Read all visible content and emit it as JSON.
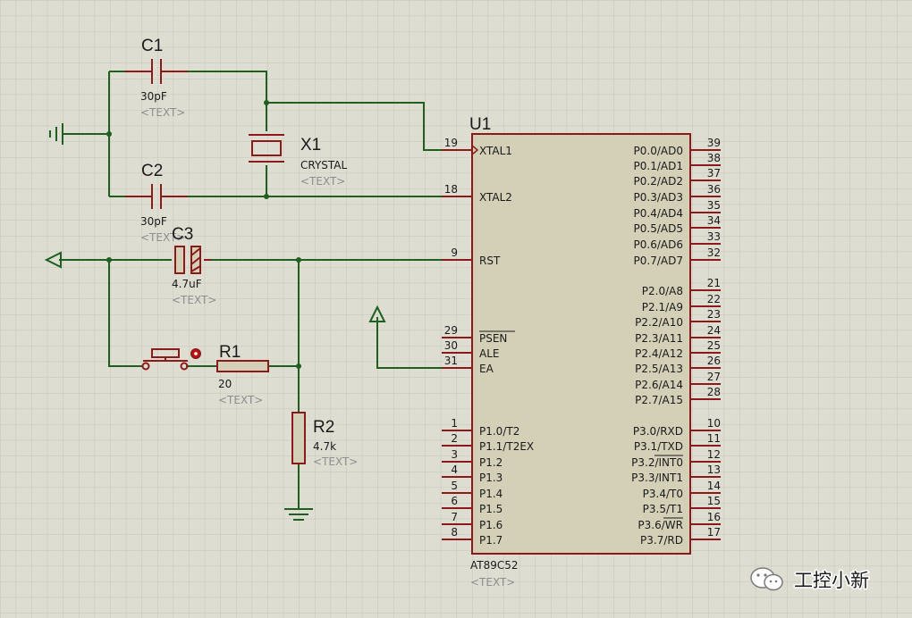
{
  "colors": {
    "background": "#ddddd2",
    "grid": "#c5c5ba",
    "wire": "#1f5f1f",
    "component": "#8b1a1a",
    "chip_fill": "#d4d0b8",
    "text": "#1a1a1a",
    "placeholder": "#8e8e8e"
  },
  "components": {
    "c1": {
      "ref": "C1",
      "value": "30pF",
      "text": "<TEXT>"
    },
    "c2": {
      "ref": "C2",
      "value": "30pF",
      "text": "<TEXT>"
    },
    "c3": {
      "ref": "C3",
      "value": "4.7uF",
      "text": "<TEXT>"
    },
    "x1": {
      "ref": "X1",
      "value": "CRYSTAL",
      "text": "<TEXT>"
    },
    "r1": {
      "ref": "R1",
      "value": "20",
      "text": "<TEXT>"
    },
    "r2": {
      "ref": "R2",
      "value": "4.7k",
      "text": "<TEXT>"
    },
    "u1": {
      "ref": "U1",
      "value": "AT89C52",
      "text": "<TEXT>"
    }
  },
  "u1_pins_left": [
    {
      "num": "19",
      "name": "XTAL1"
    },
    {
      "num": "18",
      "name": "XTAL2"
    },
    {
      "num": "9",
      "name": "RST"
    },
    {
      "num": "29",
      "name": "PSEN"
    },
    {
      "num": "30",
      "name": "ALE"
    },
    {
      "num": "31",
      "name": "EA"
    },
    {
      "num": "1",
      "name": "P1.0/T2"
    },
    {
      "num": "2",
      "name": "P1.1/T2EX"
    },
    {
      "num": "3",
      "name": "P1.2"
    },
    {
      "num": "4",
      "name": "P1.3"
    },
    {
      "num": "5",
      "name": "P1.4"
    },
    {
      "num": "6",
      "name": "P1.5"
    },
    {
      "num": "7",
      "name": "P1.6"
    },
    {
      "num": "8",
      "name": "P1.7"
    }
  ],
  "u1_pins_right": [
    {
      "num": "39",
      "name": "P0.0/AD0"
    },
    {
      "num": "38",
      "name": "P0.1/AD1"
    },
    {
      "num": "37",
      "name": "P0.2/AD2"
    },
    {
      "num": "36",
      "name": "P0.3/AD3"
    },
    {
      "num": "35",
      "name": "P0.4/AD4"
    },
    {
      "num": "34",
      "name": "P0.5/AD5"
    },
    {
      "num": "33",
      "name": "P0.6/AD6"
    },
    {
      "num": "32",
      "name": "P0.7/AD7"
    },
    {
      "num": "21",
      "name": "P2.0/A8"
    },
    {
      "num": "22",
      "name": "P2.1/A9"
    },
    {
      "num": "23",
      "name": "P2.2/A10"
    },
    {
      "num": "24",
      "name": "P2.3/A11"
    },
    {
      "num": "25",
      "name": "P2.4/A12"
    },
    {
      "num": "26",
      "name": "P2.5/A13"
    },
    {
      "num": "27",
      "name": "P2.6/A14"
    },
    {
      "num": "28",
      "name": "P2.7/A15"
    },
    {
      "num": "10",
      "name": "P3.0/RXD"
    },
    {
      "num": "11",
      "name": "P3.1/TXD"
    },
    {
      "num": "12",
      "name": "P3.2/INT0"
    },
    {
      "num": "13",
      "name": "P3.3/INT1"
    },
    {
      "num": "14",
      "name": "P3.4/T0"
    },
    {
      "num": "15",
      "name": "P3.5/T1"
    },
    {
      "num": "16",
      "name": "P3.6/WR"
    },
    {
      "num": "17",
      "name": "P3.7/RD"
    }
  ],
  "watermark": {
    "text": "工控小新",
    "icon": "wechat-icon"
  }
}
